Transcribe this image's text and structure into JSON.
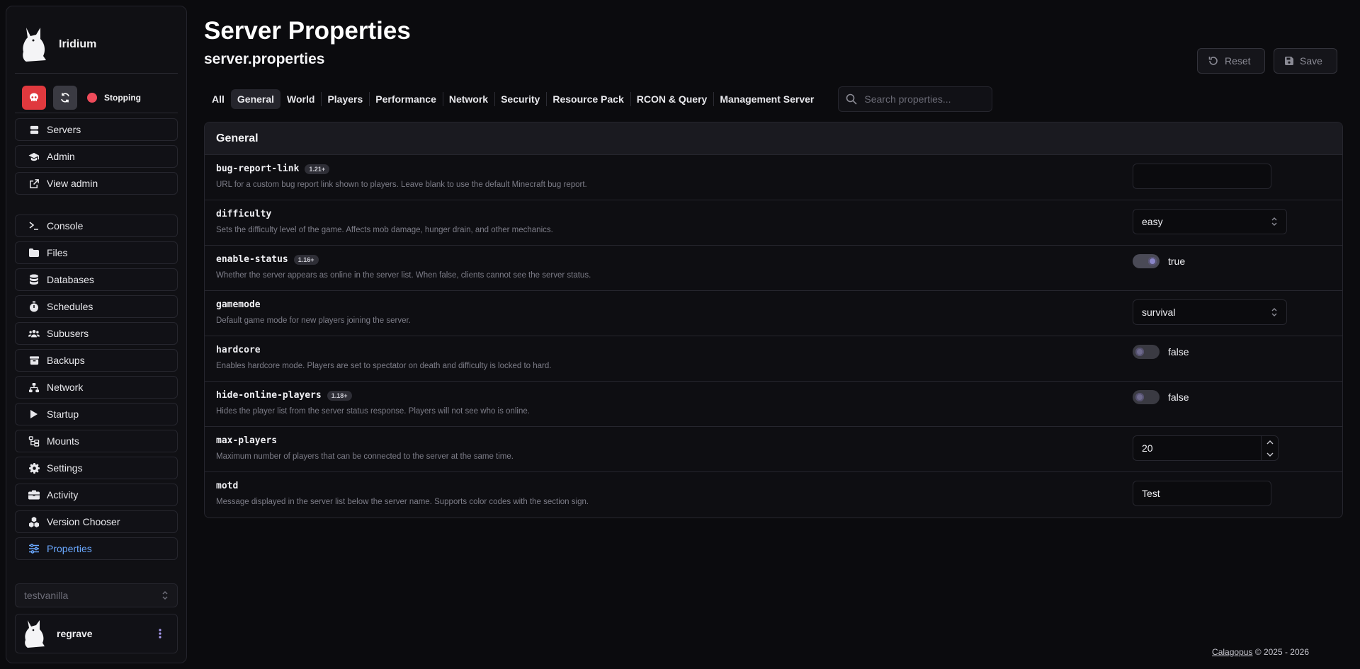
{
  "sidebar": {
    "brand": "Iridium",
    "status": "Stopping",
    "nav_group_1": [
      {
        "label": "Servers",
        "icon": "server-icon"
      },
      {
        "label": "Admin",
        "icon": "graduation-cap-icon"
      },
      {
        "label": "View admin",
        "icon": "external-link-icon"
      }
    ],
    "nav_group_2": [
      {
        "label": "Console",
        "icon": "terminal-icon"
      },
      {
        "label": "Files",
        "icon": "folder-icon"
      },
      {
        "label": "Databases",
        "icon": "database-icon"
      },
      {
        "label": "Schedules",
        "icon": "stopwatch-icon"
      },
      {
        "label": "Subusers",
        "icon": "users-icon"
      },
      {
        "label": "Backups",
        "icon": "archive-icon"
      },
      {
        "label": "Network",
        "icon": "network-icon"
      },
      {
        "label": "Startup",
        "icon": "play-icon"
      },
      {
        "label": "Mounts",
        "icon": "folder-tree-icon"
      },
      {
        "label": "Settings",
        "icon": "gear-icon"
      },
      {
        "label": "Activity",
        "icon": "briefcase-icon"
      },
      {
        "label": "Version Chooser",
        "icon": "cubes-icon"
      },
      {
        "label": "Properties",
        "icon": "sliders-icon"
      }
    ],
    "active_item": "Properties",
    "server_select": "testvanilla",
    "username": "regrave"
  },
  "header": {
    "title": "Server Properties",
    "subtitle": "server.properties",
    "reset_label": "Reset",
    "save_label": "Save"
  },
  "tabs": [
    "All",
    "General",
    "World",
    "Players",
    "Performance",
    "Network",
    "Security",
    "Resource Pack",
    "RCON & Query",
    "Management Server"
  ],
  "active_tab": "General",
  "search": {
    "placeholder": "Search properties..."
  },
  "panel": {
    "title": "General",
    "rows": [
      {
        "key": "bug-report-link",
        "badge": "1.21+",
        "desc": "URL for a custom bug report link shown to players. Leave blank to use the default Minecraft bug report.",
        "type": "text",
        "value": ""
      },
      {
        "key": "difficulty",
        "badge": "",
        "desc": "Sets the difficulty level of the game. Affects mob damage, hunger drain, and other mechanics.",
        "type": "select",
        "value": "easy"
      },
      {
        "key": "enable-status",
        "badge": "1.16+",
        "desc": "Whether the server appears as online in the server list. When false, clients cannot see the server status.",
        "type": "toggle",
        "value": "true"
      },
      {
        "key": "gamemode",
        "badge": "",
        "desc": "Default game mode for new players joining the server.",
        "type": "select",
        "value": "survival"
      },
      {
        "key": "hardcore",
        "badge": "",
        "desc": "Enables hardcore mode. Players are set to spectator on death and difficulty is locked to hard.",
        "type": "toggle",
        "value": "false"
      },
      {
        "key": "hide-online-players",
        "badge": "1.18+",
        "desc": "Hides the player list from the server status response. Players will not see who is online.",
        "type": "toggle",
        "value": "false"
      },
      {
        "key": "max-players",
        "badge": "",
        "desc": "Maximum number of players that can be connected to the server at the same time.",
        "type": "number",
        "value": "20"
      },
      {
        "key": "motd",
        "badge": "",
        "desc": "Message displayed in the server list below the server name. Supports color codes with the section sign.",
        "type": "text",
        "value": "Test"
      }
    ]
  },
  "footer": {
    "link": "Calagopus",
    "copyright": "© 2025 - 2026"
  },
  "colors": {
    "accent": "#6aa8ff",
    "danger": "#e0393e",
    "status": "#ef4b5a",
    "background": "#0b0b0e"
  }
}
